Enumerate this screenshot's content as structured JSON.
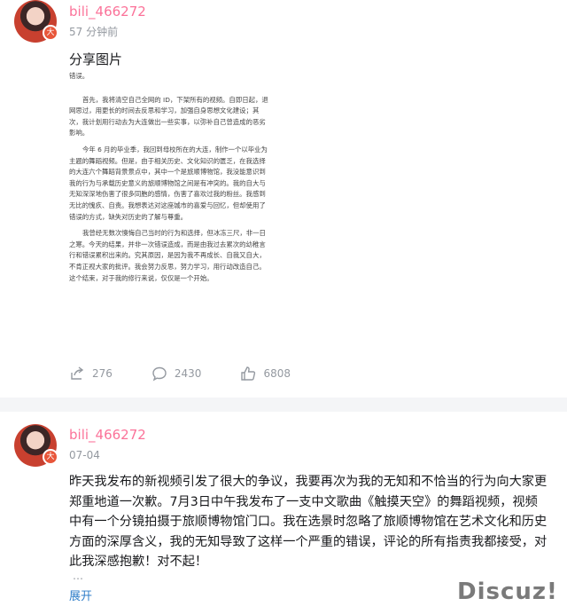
{
  "post1": {
    "username": "bili_466272",
    "time": "57 分钟前",
    "title": "分享图片",
    "badge": "大",
    "image_text": [
      "错误。",
      "首先，我将清空自己全网的 ID，下架所有的视频。自即日起，退网思过，用更长的时间去反思和学习，加强自身思想文化建设；其次，我计划用行动去为大连做出一些实事，以弥补自己曾造成的恶劣影响。",
      "今年 6 月的毕业季，我回到母校所在的大连，制作一个以毕业为主题的舞蹈视频。但是，由于相关历史、文化知识的匮乏，在我选择的大连六个舞蹈背景景点中，其中一个是旅顺博物馆，我没能意识到我的行为与承载历史意义的旅顺博物馆之间是有冲突的。我的自大与无知深深地伤害了很多同胞的感情，伤害了喜欢过我的粉丝。我感到无比的愧疚、自责。我想表达对这座城市的喜爱与回忆，但却使用了错误的方式，缺失对历史的了解与尊重。",
      "我曾经无数次懊悔自己当时的行为和选择，但冰冻三尺，非一日之寒。今天的结果，并非一次错误造成，而是由我过去累次的幼稚言行和错误累积出来的。究其原因，是因为我不再成长、自我又自大，不肯正视大家的批评。我会努力反思，努力学习，用行动改造自己。这个结束，对于我的修行来说，仅仅是一个开始。"
    ],
    "share_count": "276",
    "comment_count": "2430",
    "like_count": "6808"
  },
  "post2": {
    "username": "bili_466272",
    "time": "07-04",
    "badge": "大",
    "body": "昨天我发布的新视频引发了很大的争议，我要再次为我的无知和不恰当的行为向大家更郑重地道一次歉。7月3日中午我发布了一支中文歌曲《触摸天空》的舞蹈视频，视频中有一个分镜拍摄于旅顺博物馆门口。我在选景时忽略了旅顺博物馆在艺术文化和历史方面的深厚含义，我的无知导致了这样一个严重的错误，评论的所有指责我都接受，对此我深感抱歉！对不起！",
    "ellipsis": "…",
    "expand_label": "展开"
  },
  "watermark": "Discuz!",
  "colors": {
    "username": "#fb7299",
    "link": "#2f7ec9",
    "muted": "#9499a0"
  }
}
